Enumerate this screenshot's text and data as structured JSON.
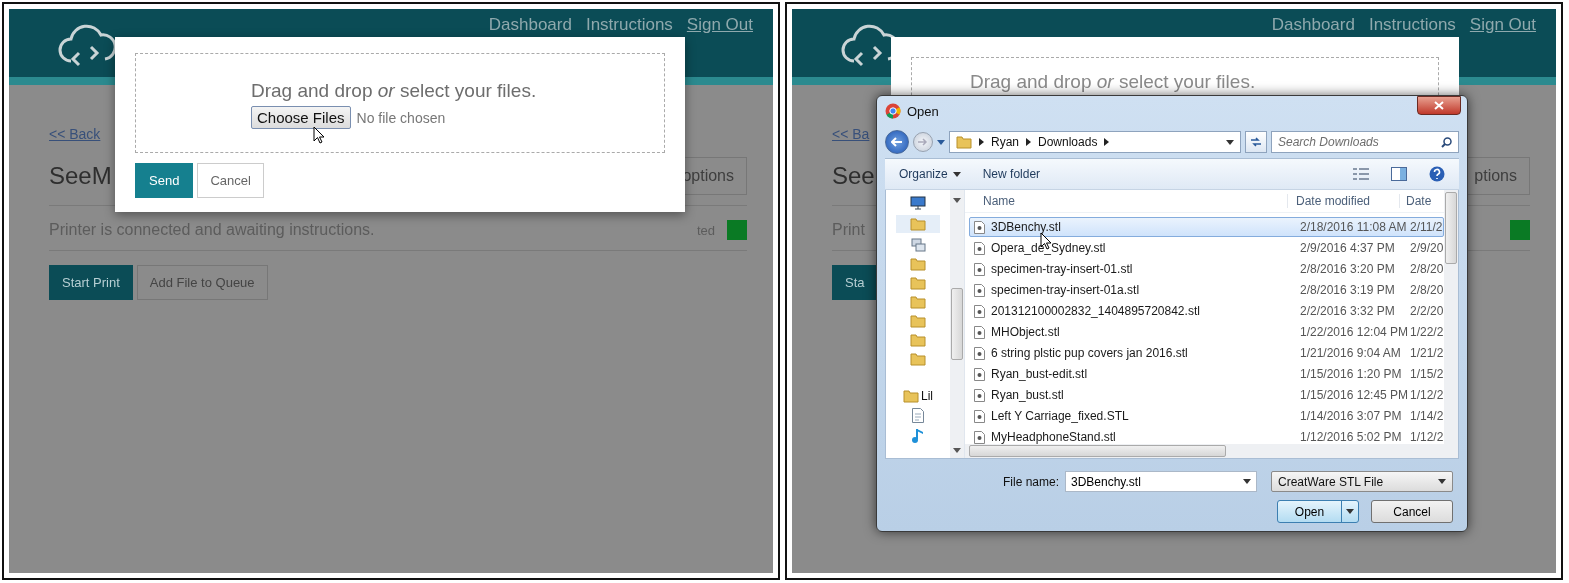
{
  "panels": [
    {
      "kind": "upload",
      "header": {
        "nav": [
          {
            "label": "Dashboard",
            "underlined": false
          },
          {
            "label": "Instructions",
            "underlined": false
          },
          {
            "label": "Sign Out",
            "underlined": true
          }
        ]
      },
      "page": {
        "back_link": "<< Back",
        "title": "SeeM",
        "options_button": "options",
        "status_text": "Printer is connected and awaiting instructions.",
        "status_label": "ted",
        "buttons": [
          {
            "label": "Start Print",
            "kind": "primary"
          },
          {
            "label": "Add File to Queue",
            "kind": "secondary"
          }
        ]
      },
      "modal": {
        "prompt": "Drag and drop *or* select your files.",
        "choose_button": "Choose Files",
        "file_status": "No file chosen",
        "send_button": "Send",
        "cancel_button": "Cancel"
      }
    },
    {
      "kind": "file_dialog",
      "header": {
        "nav": [
          {
            "label": "Dashboard",
            "underlined": false
          },
          {
            "label": "Instructions",
            "underlined": false
          },
          {
            "label": "Sign Out",
            "underlined": true
          }
        ]
      },
      "page": {
        "back_link": "<< Ba",
        "title": "See",
        "options_button": "ptions",
        "status_text": "Print",
        "buttons": [
          {
            "label": "Sta",
            "kind": "primary"
          }
        ]
      },
      "modal": {
        "prompt": "Drag and drop *or* select your files."
      },
      "dialog": {
        "title": "Open",
        "path": [
          "Ryan",
          "Downloads"
        ],
        "search_placeholder": "Search Downloads",
        "toolbar": [
          "Organize",
          "New folder"
        ],
        "library_label": "Lil",
        "columns": [
          "Name",
          "Date modified",
          "Date"
        ],
        "rows": [
          {
            "name": "3DBenchy.stl",
            "modified": "2/18/2016 11:08 AM",
            "date": "2/11/2",
            "selected": true
          },
          {
            "name": "Opera_de_Sydney.stl",
            "modified": "2/9/2016 4:37 PM",
            "date": "2/9/20",
            "selected": false
          },
          {
            "name": "specimen-tray-insert-01.stl",
            "modified": "2/8/2016 3:20 PM",
            "date": "2/8/20",
            "selected": false
          },
          {
            "name": "specimen-tray-insert-01a.stl",
            "modified": "2/8/2016 3:19 PM",
            "date": "2/8/20",
            "selected": false
          },
          {
            "name": "201312100002832_1404895720842.stl",
            "modified": "2/2/2016 3:32 PM",
            "date": "2/2/20",
            "selected": false
          },
          {
            "name": "MHObject.stl",
            "modified": "1/22/2016 12:04 PM",
            "date": "1/22/2",
            "selected": false
          },
          {
            "name": "6 string plstic pup covers jan 2016.stl",
            "modified": "1/21/2016 9:04 AM",
            "date": "1/21/2",
            "selected": false
          },
          {
            "name": "Ryan_bust-edit.stl",
            "modified": "1/15/2016 1:20 PM",
            "date": "1/15/2",
            "selected": false
          },
          {
            "name": "Ryan_bust.stl",
            "modified": "1/15/2016 12:45 PM",
            "date": "1/12/2",
            "selected": false
          },
          {
            "name": "Left Y Carriage_fixed.STL",
            "modified": "1/14/2016 3:07 PM",
            "date": "1/14/2",
            "selected": false
          },
          {
            "name": "MyHeadphoneStand.stl",
            "modified": "1/12/2016 5:02 PM",
            "date": "1/12/2",
            "selected": false
          }
        ],
        "file_name_label": "File name:",
        "file_name": "3DBenchy.stl",
        "file_type": "CreatWare STL File",
        "open_button": "Open",
        "cancel_button": "Cancel"
      }
    }
  ]
}
